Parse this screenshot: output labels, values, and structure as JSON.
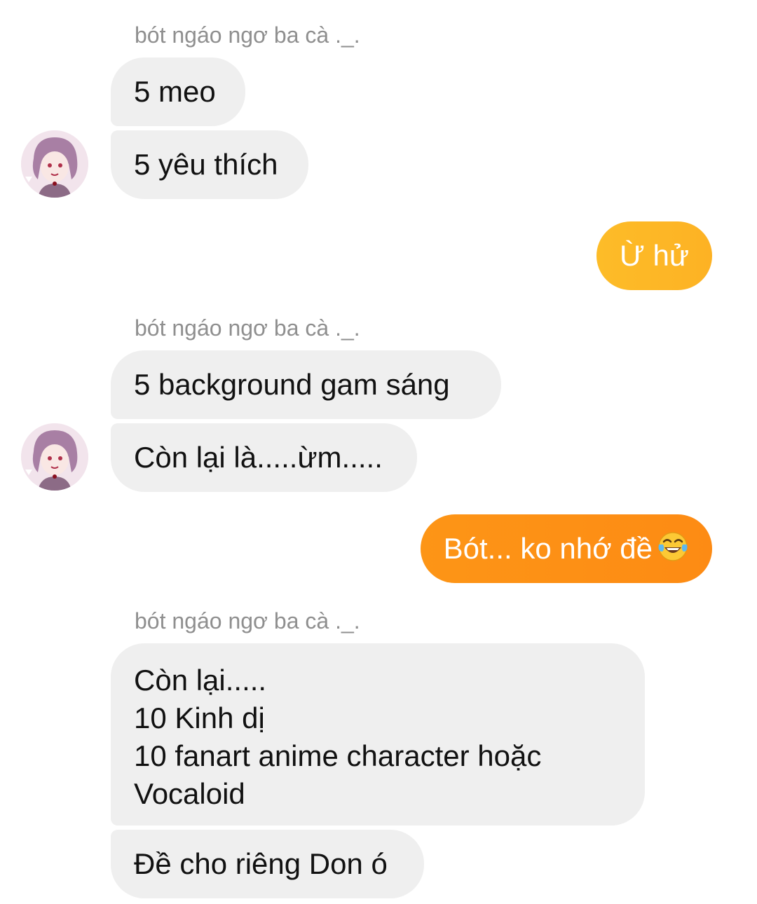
{
  "conversation": {
    "groups": [
      {
        "sender": "bót ngáo ngơ ba cà ._.",
        "messages": [
          "5 meo",
          "5 yêu thích"
        ]
      },
      {
        "sender": "bót ngáo ngơ ba cà ._.",
        "messages": [
          "5 background gam sáng",
          "Còn lại là.....ừm....."
        ]
      },
      {
        "sender": "bót ngáo ngơ ba cà ._.",
        "messages": [
          "Còn lại.....\n10 Kinh dị\n10 fanart anime character hoặc\nVocaloid",
          "Đề cho riêng Don ó"
        ]
      }
    ],
    "outgoing": [
      {
        "text": "Ừ hử"
      },
      {
        "text": "Bót... ko nhớ đề",
        "emoji": "face-with-tears-of-joy-icon"
      }
    ]
  },
  "colors": {
    "incoming_bubble": "#efefef",
    "outgoing_gradient_start": "#fdb927",
    "outgoing_gradient_end": "#fd8a14",
    "sender_name": "#8f8f8f"
  }
}
